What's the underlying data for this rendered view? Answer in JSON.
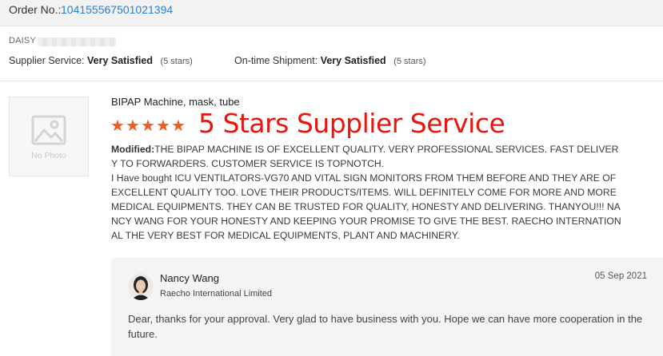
{
  "order": {
    "label": "Order No.:",
    "number": "104155567501021394"
  },
  "reviewer": {
    "name": "DAISY"
  },
  "ratings": {
    "supplier_service_label": "Supplier Service:",
    "supplier_service_value": "Very Satisfied",
    "supplier_service_stars": "(5 stars)",
    "shipment_label": "On-time Shipment:",
    "shipment_value": "Very Satisfied",
    "shipment_stars": "(5 stars)"
  },
  "product": {
    "thumbnail_text": "No Photo",
    "thumbnail_icon": "image-placeholder-icon",
    "title": "BIPAP Machine, mask, tube"
  },
  "review": {
    "star_rating": 5,
    "star_icon": "star-icon",
    "star_color": "#f05a1a",
    "headline": "5 Stars Supplier Service",
    "headline_color": "#e8160e",
    "modified_label": "Modified:",
    "text_line1": "THE BIPAP MACHINE IS OF EXCELLENT QUALITY. VERY PROFESSIONAL SERVICES. FAST DELIVERY TO FORWARDERS. CUSTOMER SERVICE IS TOPNOTCH.",
    "text_line2": "I Have bought ICU VENTILATORS-VG70 AND VITAL SIGN MONITORS FROM THEM BEFORE AND THEY ARE OF EXCELLENT QUALITY TOO. LOVE THEIR PRODUCTS/ITEMS. WILL DEFINITELY COME FOR MORE AND MORE MEDICAL EQUIPMENTS. THEY CAN BE TRUSTED FOR QUALITY, HONESTY AND DELIVERING. THANYOU!!! NANCY WANG FOR YOUR HONESTY AND KEEPING YOUR PROMISE TO GIVE THE BEST. RAECHO INTERNATIONAL THE VERY BEST FOR MEDICAL EQUIPMENTS, PLANT AND MACHINERY."
  },
  "reply": {
    "avatar_icon": "seller-avatar",
    "name": "Nancy Wang",
    "company": "Raecho International Limited",
    "date": "05 Sep 2021",
    "text": "Dear, thanks for your approval. Very glad to have business with you. Hope we can have more cooperation in the future."
  },
  "colors": {
    "link": "#2a7fcf",
    "reply_background": "#f4f4f4",
    "header_background": "#f2f2f2"
  }
}
